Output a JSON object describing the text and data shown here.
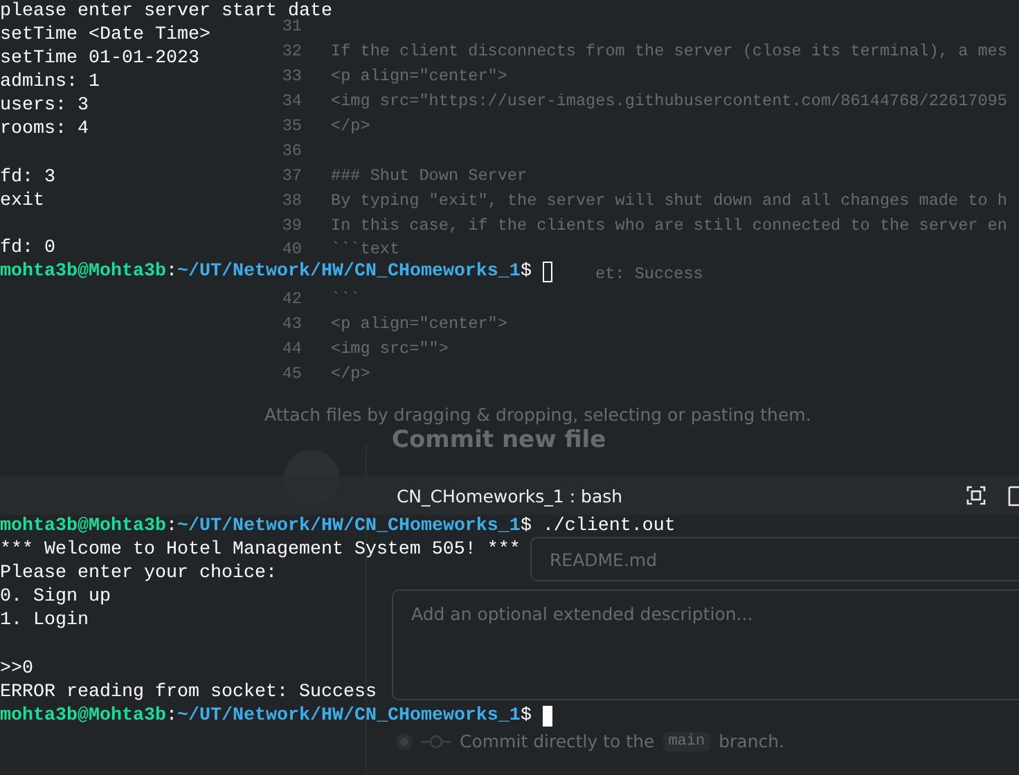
{
  "background_editor": {
    "lines": [
      {
        "number": "31"
      },
      {
        "number": "32",
        "code": "If the client disconnects from the server (close its terminal), a mes"
      },
      {
        "number": "33",
        "code": "<p align=\"center\">"
      },
      {
        "number": "34",
        "code": "<img src=\"https://user-images.githubusercontent.com/86144768/22617095"
      },
      {
        "number": "35",
        "code": "</p>"
      },
      {
        "number": "36"
      },
      {
        "number": "37",
        "code": "### Shut Down Server"
      },
      {
        "number": "38",
        "code": "By typing \"exit\", the server will shut down and all changes made to h"
      },
      {
        "number": "39",
        "code": "In this case, if the clients who are still connected to the server en"
      },
      {
        "number": "40",
        "code": "```text"
      },
      {
        "kind": "covered",
        "code": "et: Success"
      },
      {
        "number": "42",
        "code": "```"
      },
      {
        "number": "43",
        "code": "<p align=\"center\">"
      },
      {
        "number": "44",
        "code": "<img src=\"\">"
      },
      {
        "number": "45",
        "code": "</p>"
      }
    ],
    "attach_hint": "Attach files by dragging & dropping, selecting or pasting them."
  },
  "commit_form": {
    "title": "Commit new file",
    "summary_placeholder": "README.md",
    "description_placeholder": "Add an optional extended description...",
    "option": {
      "label_before": "Commit directly to the",
      "branch": "main",
      "label_after": "branch.",
      "selected": true
    }
  },
  "terminals": [
    {
      "focused": false,
      "lines": [
        {
          "kind": "output",
          "text": "please enter server start date"
        },
        {
          "kind": "output",
          "text": "setTime <Date Time>"
        },
        {
          "kind": "output",
          "text": "setTime 01-01-2023"
        },
        {
          "kind": "output",
          "text": "admins: 1"
        },
        {
          "kind": "output",
          "text": "users: 3"
        },
        {
          "kind": "output",
          "text": "rooms: 4"
        },
        {
          "kind": "blank"
        },
        {
          "kind": "output",
          "text": "fd: 3"
        },
        {
          "kind": "output",
          "text": "exit"
        },
        {
          "kind": "blank"
        },
        {
          "kind": "output",
          "text": "fd: 0"
        },
        {
          "kind": "prompt",
          "user": "mohta3b@Mohta3b",
          "separator": ":",
          "path": "~/UT/Network/HW/CN_CHomeworks_1",
          "symbol": "$"
        }
      ]
    },
    {
      "focused": true,
      "title": "CN_CHomeworks_1 : bash",
      "lines": [
        {
          "kind": "prompt",
          "user": "mohta3b@Mohta3b",
          "separator": ":",
          "path": "~/UT/Network/HW/CN_CHomeworks_1",
          "symbol": "$",
          "command": "./client.out"
        },
        {
          "kind": "output",
          "text": "*** Welcome to Hotel Management System 505! ***"
        },
        {
          "kind": "output",
          "text": "Please enter your choice:"
        },
        {
          "kind": "output",
          "text": "0. Sign up"
        },
        {
          "kind": "output",
          "text": "1. Login"
        },
        {
          "kind": "blank"
        },
        {
          "kind": "output",
          "text": ">>0"
        },
        {
          "kind": "output",
          "text": "ERROR reading from socket: Success"
        },
        {
          "kind": "prompt",
          "user": "mohta3b@Mohta3b",
          "separator": ":",
          "path": "~/UT/Network/HW/CN_CHomeworks_1",
          "symbol": "$"
        }
      ]
    }
  ]
}
